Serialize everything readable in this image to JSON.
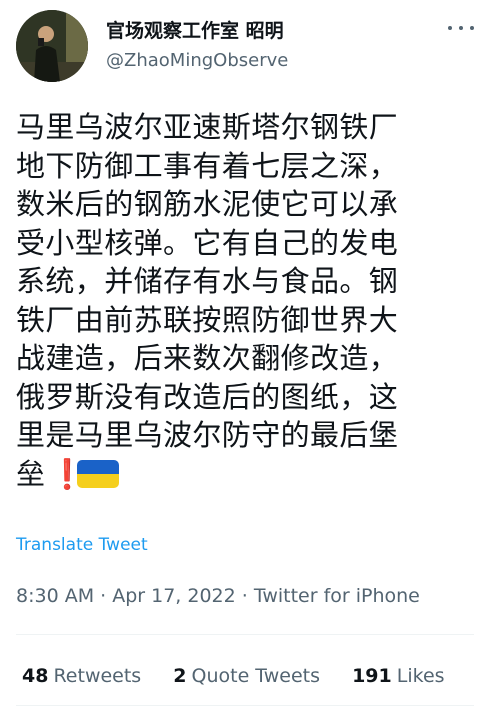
{
  "author": {
    "display_name": "官场观察工作室 昭明",
    "handle": "@ZhaoMingObserve",
    "avatar_icon": "profile-photo"
  },
  "tweet": {
    "lines": [
      "马里乌波尔亚速斯塔尔钢铁厂",
      "地下防御工事有着七层之深，",
      "数米后的钢筋水泥使它可以承",
      "受小型核弹。它有自己的发电",
      "系统，并储存有水与食品。钢",
      "铁厂由前苏联按照防御世界大",
      "战建造，后来数次翻修改造，",
      "俄罗斯没有改造后的图纸，这",
      "里是马里乌波尔防守的最后堡",
      "垒"
    ],
    "emoji_exclamation": "❗",
    "emoji_flag": "ukraine-flag",
    "translate_label": "Translate Tweet",
    "timestamp": "8:30 AM · Apr 17, 2022 · Twitter for iPhone"
  },
  "stats": {
    "retweets_count": "48",
    "retweets_label": "Retweets",
    "quotes_count": "2",
    "quotes_label": "Quote Tweets",
    "likes_count": "191",
    "likes_label": "Likes"
  },
  "colors": {
    "link": "#1d9bf0",
    "secondary_text": "#536471",
    "primary_text": "#0f1419"
  }
}
